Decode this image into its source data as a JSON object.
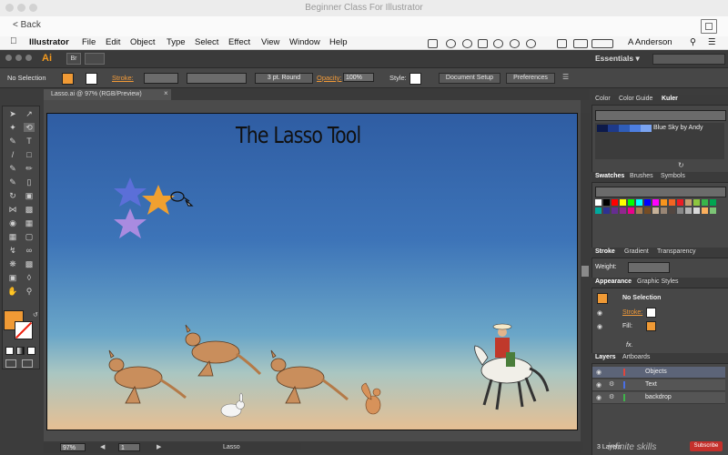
{
  "viewer": {
    "title": "Beginner Class For Illustrator",
    "back_label": "Back"
  },
  "menubar": {
    "app_name": "Illustrator",
    "items": [
      "File",
      "Edit",
      "Object",
      "Type",
      "Select",
      "Effect",
      "View",
      "Window",
      "Help"
    ],
    "user": "A Anderson"
  },
  "appbar": {
    "logo": "Ai",
    "br_label": "Br",
    "workspace": "Essentials"
  },
  "control": {
    "selection": "No Selection",
    "stroke_label": "Stroke:",
    "brush_value": "3 pt. Round",
    "opacity_label": "Opacity:",
    "opacity_value": "100%",
    "style_label": "Style:",
    "document_setup": "Document Setup",
    "preferences": "Preferences"
  },
  "document": {
    "tab": "Lasso.ai @ 97% (RGB/Preview)",
    "artboard_title": "The Lasso Tool",
    "zoom": "97%",
    "page": "1",
    "status": "Lasso"
  },
  "colors": {
    "accent_orange": "#f09a35",
    "star_blue": "#5b6fd8",
    "star_orange": "#f0a030",
    "star_lilac": "#a98be0",
    "ui_dark": "#474747"
  },
  "panels": {
    "color_tabs": [
      "Color",
      "Color Guide",
      "Kuler"
    ],
    "kuler_theme": "Blue Sky by Andy",
    "swatches_tabs": [
      "Swatches",
      "Brushes",
      "Symbols"
    ],
    "stroke_tabs": [
      "Stroke",
      "Gradient",
      "Transparency"
    ],
    "weight_label": "Weight:",
    "appearance_tabs": [
      "Appearance",
      "Graphic Styles"
    ],
    "appearance_selection": "No Selection",
    "appearance_stroke": "Stroke:",
    "appearance_fill": "Fill:",
    "appearance_fx": "fx.",
    "layers_tabs": [
      "Layers",
      "Artboards"
    ],
    "layers": [
      "Objects",
      "Text",
      "backdrop"
    ],
    "layers_count": "3 Layers"
  },
  "footer": {
    "watermark": "infinite skills",
    "subscribe": "Subscribe"
  }
}
